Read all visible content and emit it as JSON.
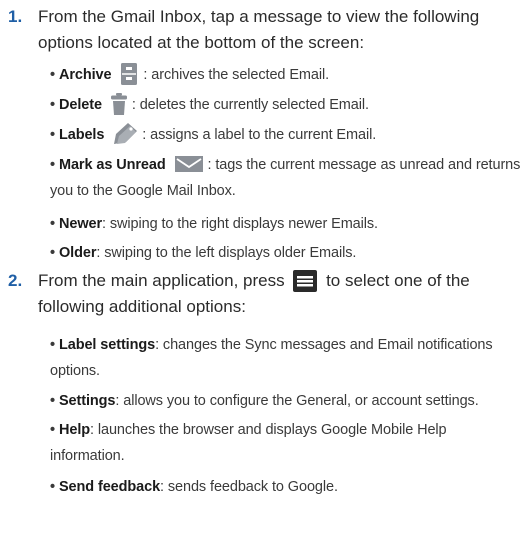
{
  "step1": {
    "number": "1.",
    "line1": "From the Gmail Inbox, tap a message to view the following",
    "line2": "options located at the bottom of the screen:",
    "bullets": [
      {
        "term": "Archive",
        "desc": ": archives the selected Email.",
        "icon": "archive-icon"
      },
      {
        "term": "Delete",
        "desc": ": deletes the currently selected Email.",
        "icon": "trash-icon"
      },
      {
        "term": "Labels",
        "desc": ": assigns a label to the current Email.",
        "icon": "label-tag-icon"
      },
      {
        "term": "Mark as Unread",
        "desc": ": tags the current message as unread and returns",
        "desc2": "you to the Google Mail Inbox.",
        "icon": "envelope-icon"
      },
      {
        "term": "Newer",
        "desc": ": swiping to the right displays newer Emails."
      },
      {
        "term": "Older",
        "desc": ": swiping to the left displays older Emails."
      }
    ]
  },
  "step2": {
    "number": "2.",
    "line1_a": "From the main application, press",
    "line1_b": "to select one of the",
    "line2": "following additional options:",
    "menu_icon": "menu-icon",
    "bullets": [
      {
        "term": "Label settings",
        "desc": ": changes the Sync messages and Email notifications",
        "desc2": "options."
      },
      {
        "term": "Settings",
        "desc": ": allows you to configure the General, or account settings."
      },
      {
        "term": "Help",
        "desc": ": launches the browser and displays Google Mobile Help",
        "desc2": "information."
      },
      {
        "term": "Send feedback",
        "desc": ": sends feedback to Google."
      }
    ]
  },
  "bullet_char": "•",
  "colors": {
    "step_number": "#1f5fa6",
    "text": "#2b2b2b",
    "icon_gray": "#8a8f96",
    "icon_green": "#7fb536"
  }
}
